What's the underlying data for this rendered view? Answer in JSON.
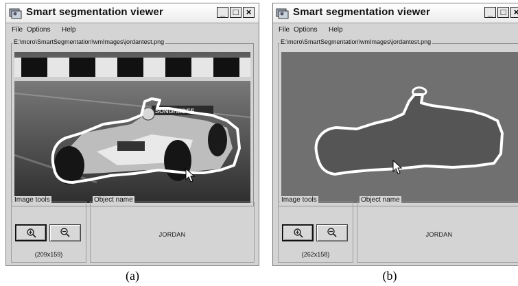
{
  "windows": [
    {
      "title": "Smart segmentation viewer",
      "menu": [
        "File",
        "Options",
        "Help"
      ],
      "file_path": "E:\\moro\\SmartSegmentation\\wmImages\\jordantest.png",
      "image_tools_label": "Image tools",
      "object_name_label": "Object name",
      "object_name": "JORDAN",
      "image_size": "(209x159)",
      "view": "original photo with segmentation outline",
      "controls": {
        "minimize": "_",
        "maximize": "□",
        "close": "×"
      }
    },
    {
      "title": "Smart segmentation viewer",
      "menu": [
        "File",
        "Options",
        "Help"
      ],
      "file_path": "E:\\moro\\SmartSegmentation\\wmImages\\jordantest.png",
      "image_tools_label": "Image tools",
      "object_name_label": "Object name",
      "object_name": "JORDAN",
      "image_size": "(262x158)",
      "view": "segmentation mask",
      "controls": {
        "minimize": "_",
        "maximize": "□",
        "close": "×"
      }
    }
  ],
  "captions": [
    "(a)",
    "(b)"
  ],
  "icons": [
    "app-icon",
    "zoom-in-icon",
    "zoom-out-icon",
    "mouse-cursor-icon"
  ],
  "colors": {
    "window_bg": "#d4d4d4",
    "mask_background": "#707070",
    "mask_object": "#555555",
    "outline": "#ffffff"
  }
}
